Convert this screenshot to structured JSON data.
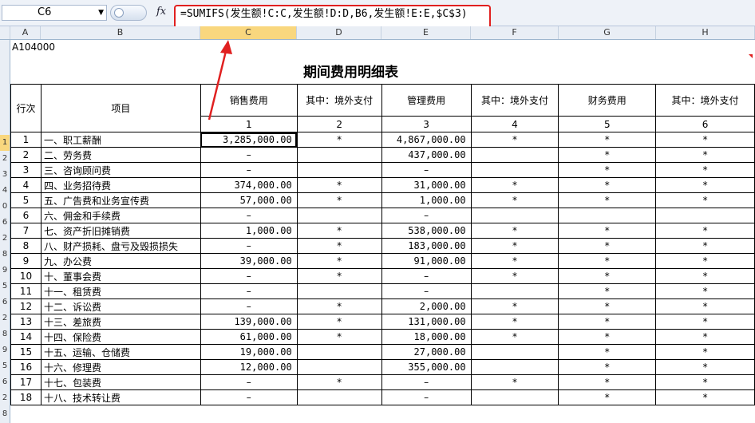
{
  "name_box": "C6",
  "fx_label": "fx",
  "formula": "=SUMIFS(发生额!C:C,发生额!D:D,B6,发生额!E:E,$C$3)",
  "columns": [
    "A",
    "B",
    "C",
    "D",
    "E",
    "F",
    "G",
    "H"
  ],
  "row_numbers": [
    "",
    "",
    "",
    "",
    "",
    "",
    "1",
    "2",
    "3",
    "4",
    "0",
    "6",
    "2",
    "8",
    "9",
    "5",
    "6",
    "2",
    "8",
    "9",
    "5",
    "6",
    "2",
    "8"
  ],
  "report_code": "A104000",
  "report_title": "期间费用明细表",
  "header": {
    "row_no": "行次",
    "item": "项目",
    "c1": "销售费用",
    "c2": "其中：境外支付",
    "c3": "管理费用",
    "c4": "其中：境外支付",
    "c5": "财务费用",
    "c6": "其中：境外支付"
  },
  "col_numbers": [
    "1",
    "2",
    "3",
    "4",
    "5",
    "6"
  ],
  "rows": [
    {
      "no": "1",
      "item": "一、职工薪酬",
      "c1": "3,285,000.00",
      "c2": "*",
      "c3": "4,867,000.00",
      "c4": "*",
      "c5": "*",
      "c6": "*"
    },
    {
      "no": "2",
      "item": "二、劳务费",
      "c1": "–",
      "c2": "",
      "c3": "437,000.00",
      "c4": "",
      "c5": "*",
      "c6": "*"
    },
    {
      "no": "3",
      "item": "三、咨询顾问费",
      "c1": "–",
      "c2": "",
      "c3": "–",
      "c4": "",
      "c5": "*",
      "c6": "*"
    },
    {
      "no": "4",
      "item": "四、业务招待费",
      "c1": "374,000.00",
      "c2": "*",
      "c3": "31,000.00",
      "c4": "*",
      "c5": "*",
      "c6": "*"
    },
    {
      "no": "5",
      "item": "五、广告费和业务宣传费",
      "c1": "57,000.00",
      "c2": "*",
      "c3": "1,000.00",
      "c4": "*",
      "c5": "*",
      "c6": "*"
    },
    {
      "no": "6",
      "item": "六、佣金和手续费",
      "c1": "–",
      "c2": "",
      "c3": "–",
      "c4": "",
      "c5": "",
      "c6": ""
    },
    {
      "no": "7",
      "item": "七、资产折旧摊销费",
      "c1": "1,000.00",
      "c2": "*",
      "c3": "538,000.00",
      "c4": "*",
      "c5": "*",
      "c6": "*"
    },
    {
      "no": "8",
      "item": "八、财产损耗、盘亏及毁损损失",
      "c1": "–",
      "c2": "*",
      "c3": "183,000.00",
      "c4": "*",
      "c5": "*",
      "c6": "*"
    },
    {
      "no": "9",
      "item": "九、办公费",
      "c1": "39,000.00",
      "c2": "*",
      "c3": "91,000.00",
      "c4": "*",
      "c5": "*",
      "c6": "*"
    },
    {
      "no": "10",
      "item": "十、董事会费",
      "c1": "–",
      "c2": "*",
      "c3": "–",
      "c4": "*",
      "c5": "*",
      "c6": "*"
    },
    {
      "no": "11",
      "item": "十一、租赁费",
      "c1": "–",
      "c2": "",
      "c3": "–",
      "c4": "",
      "c5": "*",
      "c6": "*"
    },
    {
      "no": "12",
      "item": "十二、诉讼费",
      "c1": "–",
      "c2": "*",
      "c3": "2,000.00",
      "c4": "*",
      "c5": "*",
      "c6": "*"
    },
    {
      "no": "13",
      "item": "十三、差旅费",
      "c1": "139,000.00",
      "c2": "*",
      "c3": "131,000.00",
      "c4": "*",
      "c5": "*",
      "c6": "*"
    },
    {
      "no": "14",
      "item": "十四、保险费",
      "c1": "61,000.00",
      "c2": "*",
      "c3": "18,000.00",
      "c4": "*",
      "c5": "*",
      "c6": "*"
    },
    {
      "no": "15",
      "item": "十五、运输、仓储费",
      "c1": "19,000.00",
      "c2": "",
      "c3": "27,000.00",
      "c4": "",
      "c5": "*",
      "c6": "*"
    },
    {
      "no": "16",
      "item": "十六、修理费",
      "c1": "12,000.00",
      "c2": "",
      "c3": "355,000.00",
      "c4": "",
      "c5": "*",
      "c6": "*"
    },
    {
      "no": "17",
      "item": "十七、包装费",
      "c1": "–",
      "c2": "*",
      "c3": "–",
      "c4": "*",
      "c5": "*",
      "c6": "*"
    },
    {
      "no": "18",
      "item": "十八、技术转让费",
      "c1": "–",
      "c2": "",
      "c3": "–",
      "c4": "",
      "c5": "*",
      "c6": "*"
    }
  ],
  "colors": {
    "highlight_border": "#e02020",
    "selected_header": "#f9d77e"
  }
}
